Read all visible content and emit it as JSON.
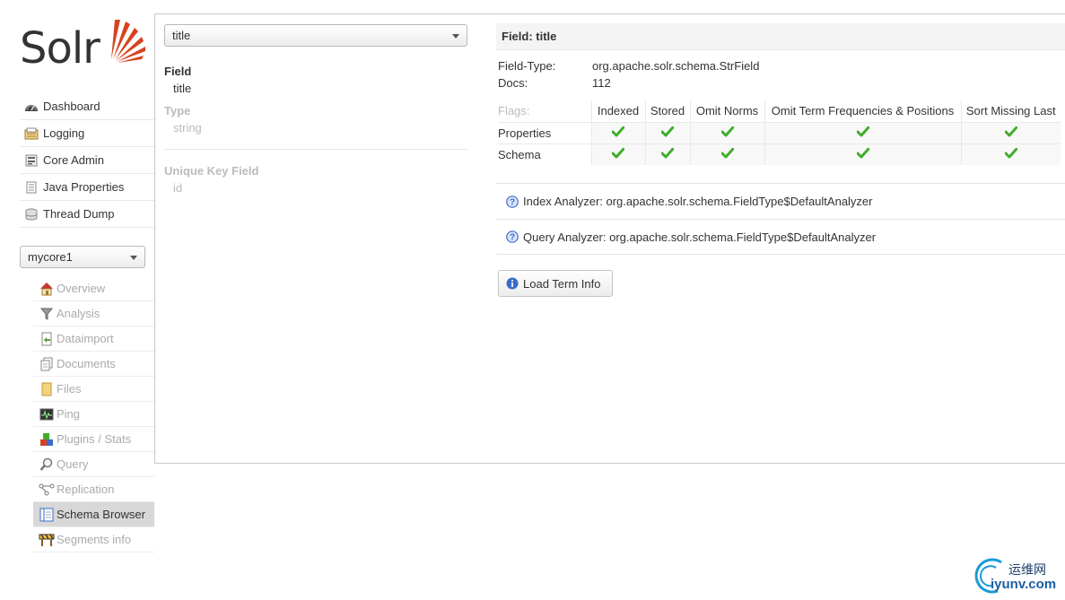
{
  "logo": {
    "text": "Solr"
  },
  "menu": [
    {
      "label": "Dashboard",
      "icon": "dashboard-icon"
    },
    {
      "label": "Logging",
      "icon": "logging-icon"
    },
    {
      "label": "Core Admin",
      "icon": "core-admin-icon"
    },
    {
      "label": "Java Properties",
      "icon": "java-properties-icon"
    },
    {
      "label": "Thread Dump",
      "icon": "thread-dump-icon"
    }
  ],
  "core_selector": {
    "value": "mycore1"
  },
  "core_menu": [
    {
      "label": "Overview",
      "icon": "home-icon"
    },
    {
      "label": "Analysis",
      "icon": "funnel-icon"
    },
    {
      "label": "Dataimport",
      "icon": "dataimport-icon"
    },
    {
      "label": "Documents",
      "icon": "documents-icon"
    },
    {
      "label": "Files",
      "icon": "files-icon"
    },
    {
      "label": "Ping",
      "icon": "ping-icon"
    },
    {
      "label": "Plugins / Stats",
      "icon": "plugins-icon"
    },
    {
      "label": "Query",
      "icon": "magnifier-icon"
    },
    {
      "label": "Replication",
      "icon": "replication-icon"
    },
    {
      "label": "Schema Browser",
      "icon": "schema-browser-icon",
      "active": true
    },
    {
      "label": "Segments info",
      "icon": "segments-icon"
    }
  ],
  "field_selector": {
    "value": "title"
  },
  "field_info": {
    "field_heading": "Field",
    "field_value": "title",
    "type_heading": "Type",
    "type_value": "string",
    "unique_key_heading": "Unique Key Field",
    "unique_key_value": "id"
  },
  "detail": {
    "title": "Field: title",
    "field_type_label": "Field-Type:",
    "field_type_value": "org.apache.solr.schema.StrField",
    "docs_label": "Docs:",
    "docs_value": "112"
  },
  "flags": {
    "header_label": "Flags:",
    "columns": [
      "Indexed",
      "Stored",
      "Omit Norms",
      "Omit Term Frequencies & Positions",
      "Sort Missing Last"
    ],
    "rows": [
      {
        "label": "Properties",
        "checks": [
          true,
          true,
          true,
          true,
          true
        ]
      },
      {
        "label": "Schema",
        "checks": [
          true,
          true,
          true,
          true,
          true
        ]
      }
    ],
    "check_color": "#3fae2a"
  },
  "analyzers": {
    "index": "Index Analyzer: org.apache.solr.schema.FieldType$DefaultAnalyzer",
    "query": "Query Analyzer: org.apache.solr.schema.FieldType$DefaultAnalyzer"
  },
  "load_term_button": "Load Term Info",
  "watermark": {
    "cn": "运维网",
    "en": "iyunv.com"
  },
  "colors": {
    "brand": "#d9411e",
    "info": "#3a6cc8"
  }
}
